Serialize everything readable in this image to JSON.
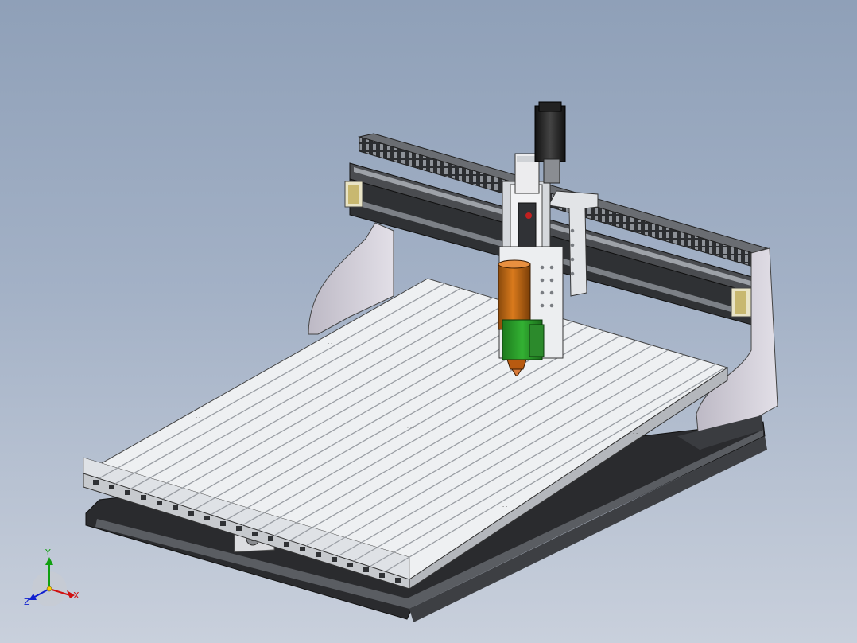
{
  "viewport": {
    "background_top": "#8fa0b8",
    "background_bottom": "#c9d0dc"
  },
  "model": {
    "frame_color": "#d8d6de",
    "table_color": "#e9ecef",
    "rail_color": "#3a3c40",
    "spindle_color": "#c86a12",
    "clamp_color": "#2a9a2a"
  },
  "triad": {
    "x_label": "X",
    "y_label": "Y",
    "z_label": "Z",
    "x_color": "#d01010",
    "y_color": "#10a010",
    "z_color": "#1020d0"
  }
}
